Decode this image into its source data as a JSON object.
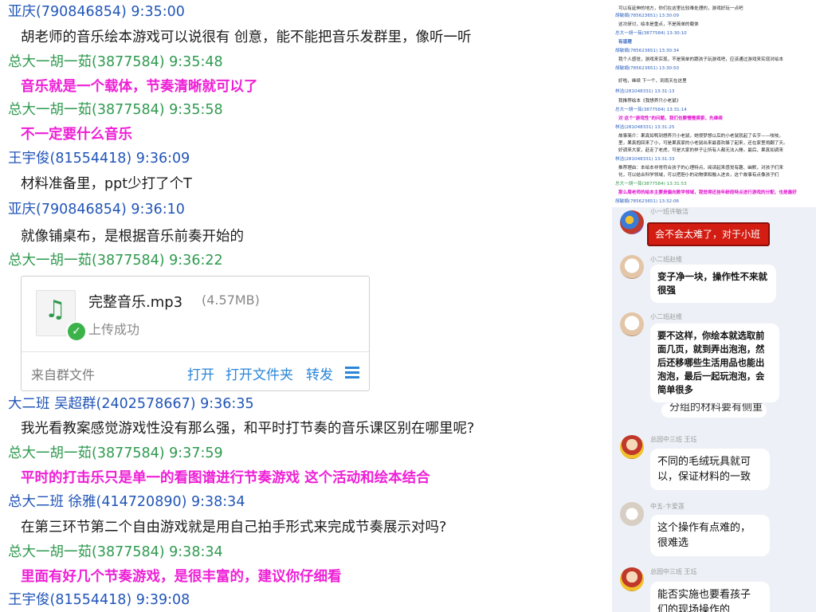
{
  "left_chat": {
    "messages": [
      {
        "sender": "亚庆(790846854) 9:35:00",
        "text": "胡老师的音乐绘本游戏可以说很有 创意，能不能把音乐发群里，像听一听"
      },
      {
        "sender": "总大一胡一茹(3877584) 9:35:48",
        "text": "音乐就是一个载体，节奏清晰就可以了"
      },
      {
        "sender": "总大一胡一茹(3877584) 9:35:58",
        "text": "不一定要什么音乐"
      },
      {
        "sender": "王宇俊(81554418) 9:36:09",
        "text": "材料准备里，ppt少打了个T"
      },
      {
        "sender": "亚庆(790846854) 9:36:10",
        "text": "就像铺桌布，是根据音乐前奏开始的"
      },
      {
        "sender": "总大一胡一茹(3877584) 9:36:22",
        "text": ""
      },
      {
        "sender": "大二班 吴超群(2402578667) 9:36:35",
        "text": "我光看教案感觉游戏性没有那么强，和平时打节奏的音乐课区别在哪里呢?"
      },
      {
        "sender": "总大一胡一茹(3877584) 9:37:59",
        "text": "平时的打击乐只是单一的看图谱进行节奏游戏 这个活动和绘本结合"
      },
      {
        "sender": "总大二班    徐雅(414720890) 9:38:34",
        "text": "在第三环节第二个自由游戏就是用自己拍手形式来完成节奏展示对吗?"
      },
      {
        "sender": "总大一胡一茹(3877584) 9:38:34",
        "text": "里面有好几个节奏游戏，是很丰富的，建议你仔细看"
      },
      {
        "sender": "王宇俊(81554418) 9:39:08",
        "text": ""
      }
    ],
    "file_card": {
      "name": "完整音乐.mp3",
      "size": "(4.57MB)",
      "status": "上传成功",
      "source": "来自群文件",
      "actions": [
        "打开",
        "打开文件夹",
        "转发"
      ]
    }
  },
  "top_right_chat": {
    "lines": [
      "可以有延伸的地方，你们在这里比较难处理的，游戏好玩一点吧",
      "胡敏娟(785623651) 13:30:09",
      "这次研讨，绘本是重点，不是简单的载体",
      "总大一胡一茹(3877584) 13:30:10",
      "有道理",
      "胡敏娟(785623651) 13:30:34",
      "我个人感觉，游戏来实现，不是简单的跟孩子玩游戏吧，应该通过游戏来实现对绘本",
      "胡敏娟(785623651) 13:30:50",
      "好啦，继续 下一个，到雨天在这里",
      "林洁(281048331) 13:31:13",
      "我推荐绘本《我想养只小老鼠》",
      "总大一胡一茹(3877584) 13:31:14",
      "对 这个\"游戏性\"的问题，我们也要慢慢摸索，先继续",
      "林洁(281048331) 13:31:25",
      "故事简介：果真如鸭到想养只小老鼠，她很梦想以后的小老鼠就起了名字——吱吱。",
      "里，果真抱回来了小，可是果真家的小老鼠出来最喜欢躲了起来，还在家里闹翻了天。",
      "好调来大家，赶走了老虎，可是大家的样子让所有人都无法入睡。最后，果真如调来",
      "林洁(281048331) 13:31:33",
      "推荐理由：本绘本非常符合孩子的心理特点，阅读起来感觉有趣、幽默，对孩子们来",
      "化，可以结合科学领域，可以把胆小的动物律和融入进去，这个故事有点像孩子们",
      "总大一胡一茹(3877584) 13:31:53",
      "那么周老师的绘本主要是偏向数学领域，我觉得还挂年龄段特点进行游戏的分配，也是最好",
      "胡敏娟(785623651) 13:32:06"
    ]
  },
  "bottom_right_chat": {
    "messages": [
      {
        "sender": "小一班许敏洁",
        "lines": [
          "会不会太难了，对于小班"
        ]
      },
      {
        "sender": "小二班赵维",
        "lines": [
          "变子净一块，操作性不来就",
          "很强"
        ]
      },
      {
        "sender": "小二班赵维",
        "lines": [
          "要不这样，你绘本就选取前",
          "面几页，就到弄出泡泡，然",
          "后还移哪些生活用品也能出",
          "泡泡，最后一起玩泡泡，会",
          "简单很多"
        ]
      },
      {
        "sender": "",
        "lines": [
          "分组的材料要有侧重"
        ]
      },
      {
        "sender": "总园中三班 王珏",
        "lines": [
          "不同的毛绒玩具就可",
          "以，保证材料的一致"
        ]
      },
      {
        "sender": "中五-卞爱莲",
        "lines": [
          "这个操作有点难的，",
          "很难选"
        ]
      },
      {
        "sender": "总园中三班 王珏",
        "lines": [
          "能否实施也要看孩子",
          "们的现场操作的"
        ]
      }
    ]
  },
  "colors": {
    "sender_green": "#2f9a4f",
    "sender_blue": "#2155b8",
    "highlight_magenta": "#ee1fd6",
    "link_blue": "#2a86d8",
    "red_bubble": "#d31c12",
    "mobile_bg": "#edf1f7"
  },
  "icons": [
    "music-file-icon",
    "success-check-icon",
    "menu-icon"
  ]
}
